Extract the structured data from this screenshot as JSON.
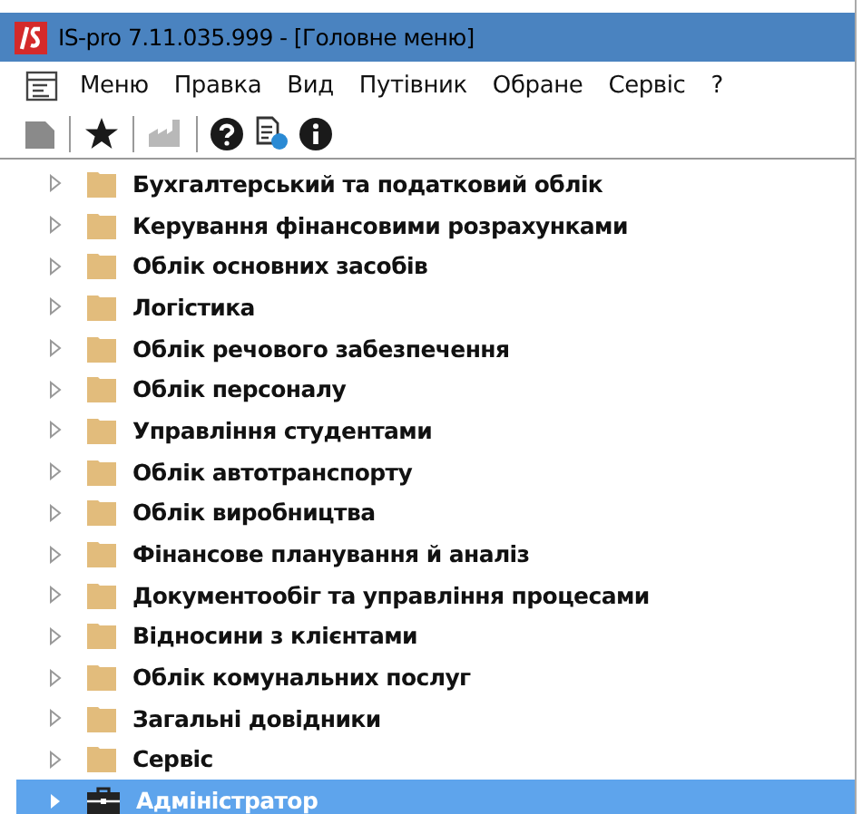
{
  "window": {
    "title": "IS-pro 7.11.035.999 - [Головне меню]"
  },
  "menu": [
    "Меню",
    "Правка",
    "Вид",
    "Путівник",
    "Обране",
    "Сервіс",
    "?"
  ],
  "toolbar": [
    {
      "kind": "block",
      "disabled": true
    },
    {
      "kind": "separator"
    },
    {
      "kind": "star",
      "disabled": false
    },
    {
      "kind": "separator"
    },
    {
      "kind": "factory",
      "disabled": true
    },
    {
      "kind": "separator"
    },
    {
      "kind": "help",
      "disabled": false
    },
    {
      "kind": "doc-help",
      "disabled": false
    },
    {
      "kind": "info",
      "disabled": false
    }
  ],
  "tree": [
    {
      "label": "Бухгалтерський та податковий облік",
      "kind": "folder",
      "selected": false,
      "expanded": false
    },
    {
      "label": "Керування фінансовими розрахунками",
      "kind": "folder",
      "selected": false,
      "expanded": false
    },
    {
      "label": "Облік основних засобів",
      "kind": "folder",
      "selected": false,
      "expanded": false
    },
    {
      "label": "Логістика",
      "kind": "folder",
      "selected": false,
      "expanded": false
    },
    {
      "label": "Облік речового забезпечення",
      "kind": "folder",
      "selected": false,
      "expanded": false
    },
    {
      "label": "Облік персоналу",
      "kind": "folder",
      "selected": false,
      "expanded": false
    },
    {
      "label": "Управління студентами",
      "kind": "folder",
      "selected": false,
      "expanded": false
    },
    {
      "label": "Облік автотранспорту",
      "kind": "folder",
      "selected": false,
      "expanded": false
    },
    {
      "label": "Облік виробництва",
      "kind": "folder",
      "selected": false,
      "expanded": false
    },
    {
      "label": "Фінансове планування й аналіз",
      "kind": "folder",
      "selected": false,
      "expanded": false
    },
    {
      "label": "Документообіг та управління процесами",
      "kind": "folder",
      "selected": false,
      "expanded": false
    },
    {
      "label": "Відносини з клієнтами",
      "kind": "folder",
      "selected": false,
      "expanded": false
    },
    {
      "label": "Облік комунальних послуг",
      "kind": "folder",
      "selected": false,
      "expanded": false
    },
    {
      "label": "Загальні довідники",
      "kind": "folder",
      "selected": false,
      "expanded": false
    },
    {
      "label": "Сервіс",
      "kind": "folder",
      "selected": false,
      "expanded": false
    },
    {
      "label": "Адміністратор",
      "kind": "briefcase",
      "selected": true,
      "expanded": false
    }
  ]
}
